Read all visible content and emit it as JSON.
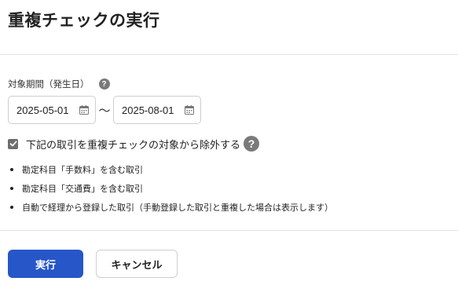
{
  "dialog": {
    "title": "重複チェックの実行"
  },
  "period": {
    "label": "対象期間（発生日）",
    "help_icon": "?",
    "start_date": "2025-05-01",
    "separator": "〜",
    "end_date": "2025-08-01",
    "calendar_icon": "calendar-icon"
  },
  "exclude": {
    "checked": true,
    "label": "下記の取引を重複チェックの対象から除外する",
    "help_icon": "?",
    "items": [
      "勘定科目「手数料」を含む取引",
      "勘定科目「交通費」を含む取引",
      "自動で経理から登録した取引（手動登録した取引と重複した場合は表示します）"
    ]
  },
  "actions": {
    "run_label": "実行",
    "cancel_label": "キャンセル"
  },
  "colors": {
    "primary": "#2756c8",
    "icon_gray": "#7a7a7a",
    "border": "#cfcfcf"
  }
}
